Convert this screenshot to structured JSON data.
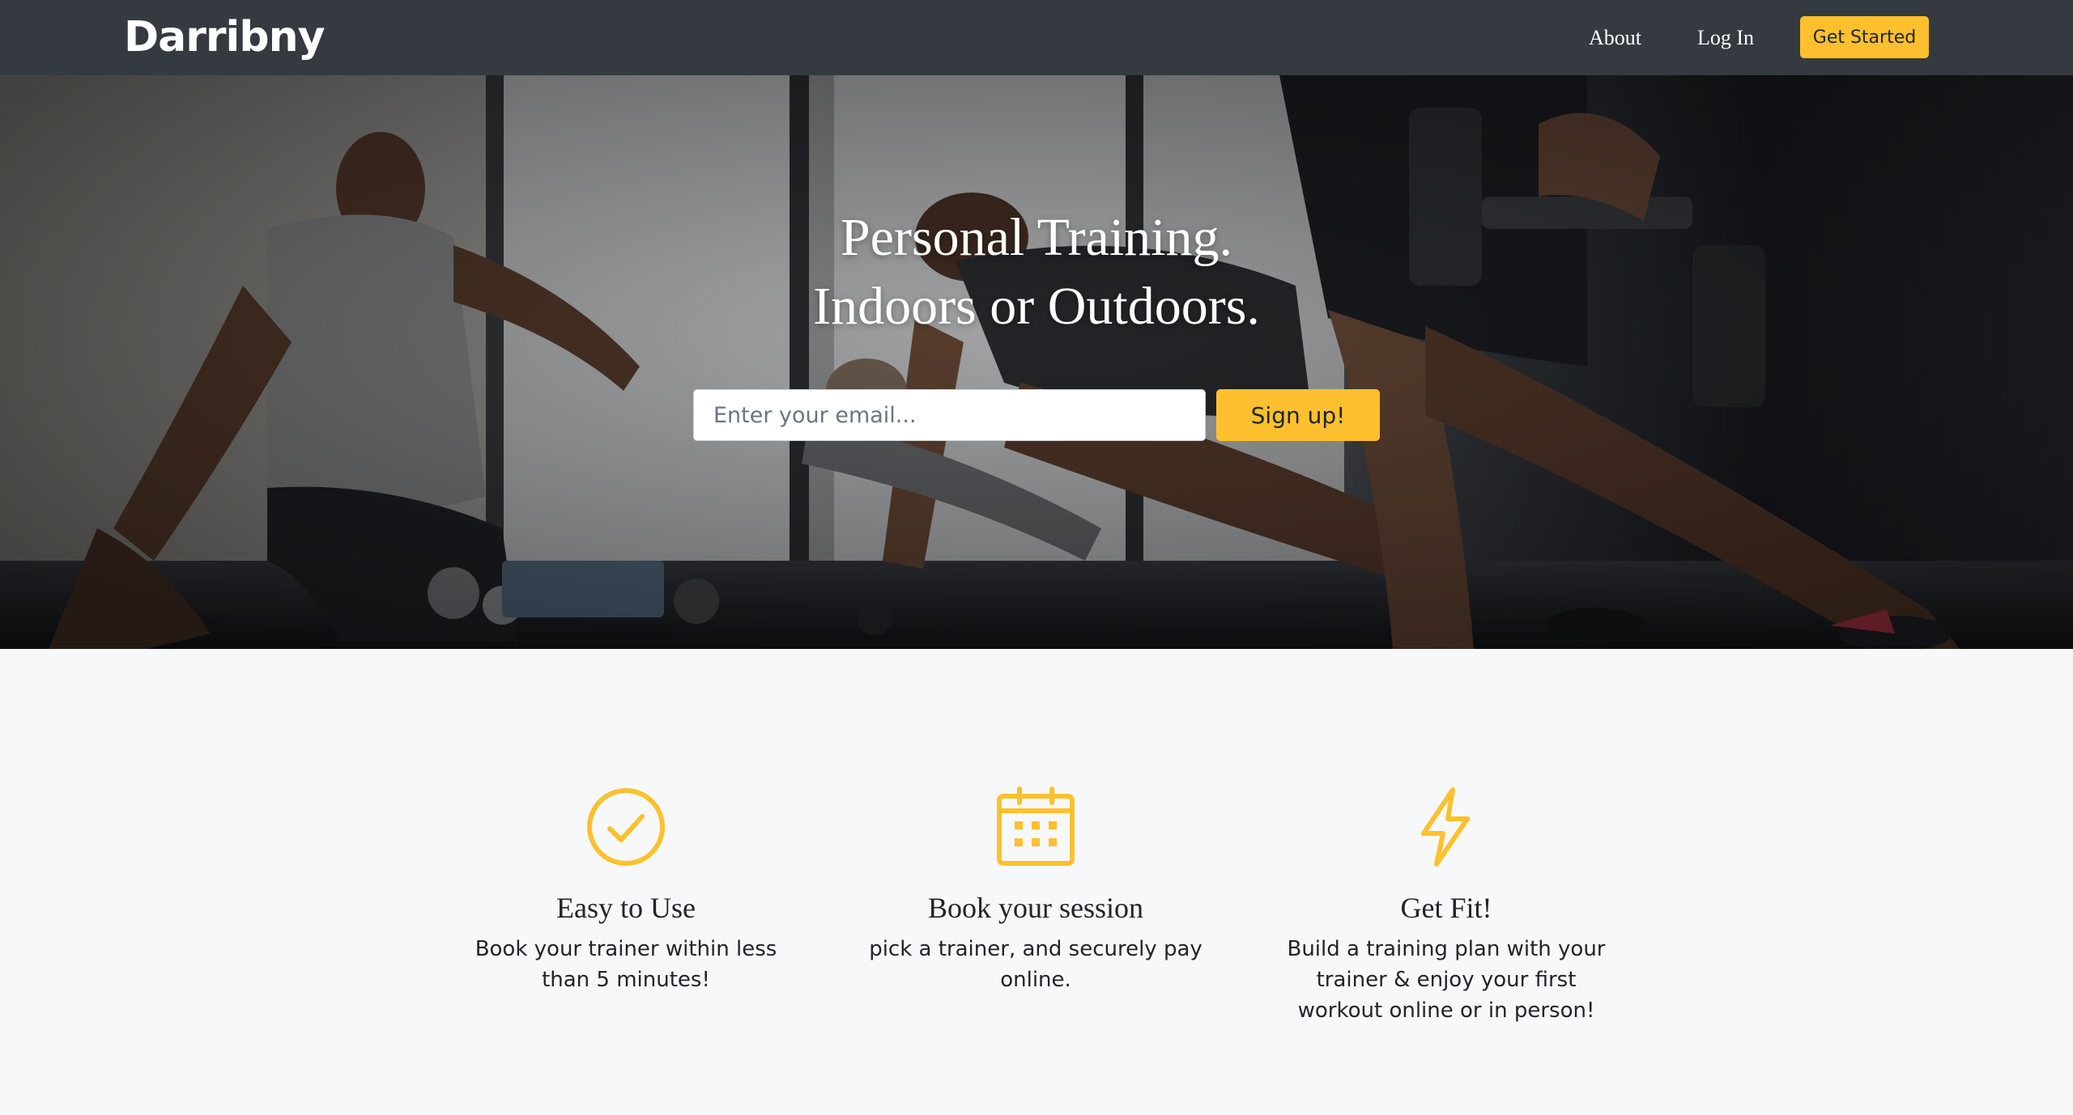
{
  "navbar": {
    "brand": "Darribny",
    "links": {
      "about": "About",
      "login": "Log In"
    },
    "cta": "Get Started"
  },
  "hero": {
    "title_line1": "Personal Training.",
    "title_line2": "Indoors or Outdoors.",
    "email_placeholder": "Enter your email...",
    "email_value": "",
    "signup_label": "Sign up!"
  },
  "features": [
    {
      "icon": "check-circle-icon",
      "title": "Easy to Use",
      "description": "Book your trainer within less than 5 minutes!"
    },
    {
      "icon": "calendar-icon",
      "title": "Book your session",
      "description": "pick a trainer, and securely pay online."
    },
    {
      "icon": "lightning-icon",
      "title": "Get Fit!",
      "description": "Build a training plan with your trainer & enjoy your first workout online or in person!"
    }
  ],
  "colors": {
    "navbar_bg": "#343a40",
    "accent": "#fec02e",
    "page_bg": "#f7f8f9",
    "text": "#212529"
  }
}
